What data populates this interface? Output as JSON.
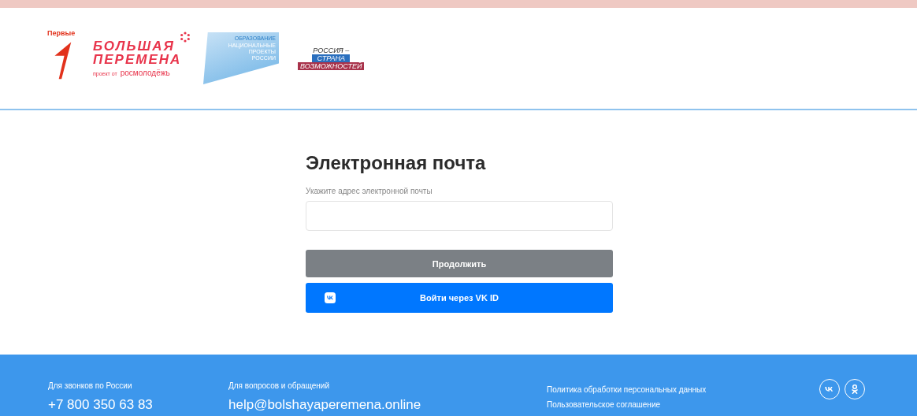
{
  "logos": {
    "pervye": "Первые",
    "bp_line1": "БОЛЬШАЯ",
    "bp_line2": "ПЕРЕМЕНА",
    "bp_sub": "проект от",
    "bp_brand": "росмолодёжь",
    "np_top": "ОБРАЗОВАНИЕ",
    "np_main": "НАЦИОНАЛЬНЫЕ ПРОЕКТЫ РОССИИ",
    "rs_line1": "РОССИЯ –",
    "rs_line2": "СТРАНА",
    "rs_line3": "ВОЗМОЖНОСТЕЙ"
  },
  "form": {
    "title": "Электронная почта",
    "label": "Укажите адрес электронной почты",
    "buttons": [
      {
        "kind": "primary",
        "label": "Продолжить"
      },
      {
        "kind": "vk",
        "label": "Войти через VK ID"
      }
    ]
  },
  "footer": {
    "columns": [
      {
        "caption": "Для звонков по России",
        "value": "+7 800 350 63 83"
      },
      {
        "caption": "Для вопросов и обращений",
        "value": "help@bolshayaperemena.online"
      }
    ],
    "links": [
      "Политика обработки персональных данных",
      "Пользовательское соглашение"
    ],
    "social": [
      {
        "kind": "vk"
      },
      {
        "kind": "ok"
      }
    ]
  }
}
